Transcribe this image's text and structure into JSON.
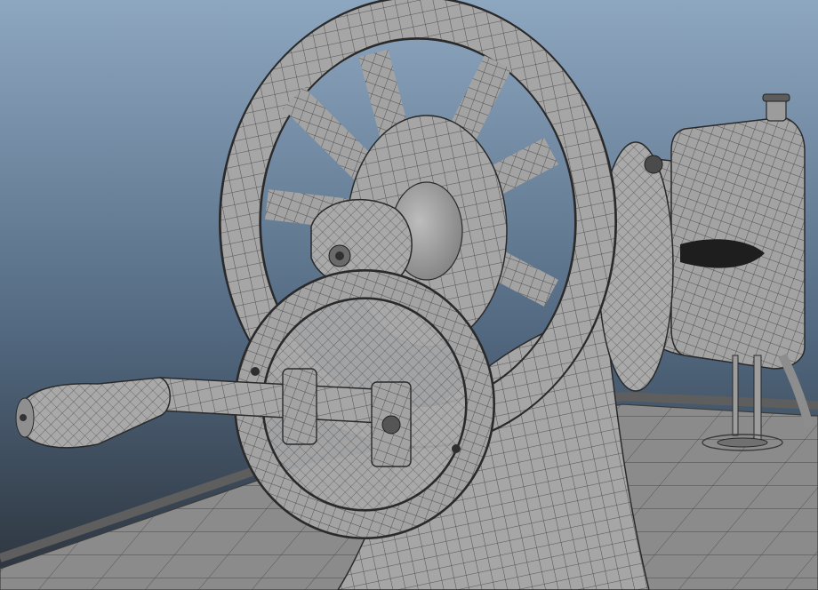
{
  "viewport": {
    "background_top": "#8ea7c0",
    "background_mid": "#536a82",
    "background_bottom": "#2b323b",
    "model_color": "#a4a4a4",
    "wire_color": "#2b2b2b",
    "floor_color": "#8c8c8c"
  },
  "scene": {
    "components": [
      "floor-plane",
      "machine-base",
      "arm-bell",
      "side-cover",
      "balance-handwheel",
      "bobbin-winder-hub",
      "crank-gear-ring",
      "crank-arm",
      "crank-handle",
      "presser-foot-needle-bar"
    ]
  }
}
